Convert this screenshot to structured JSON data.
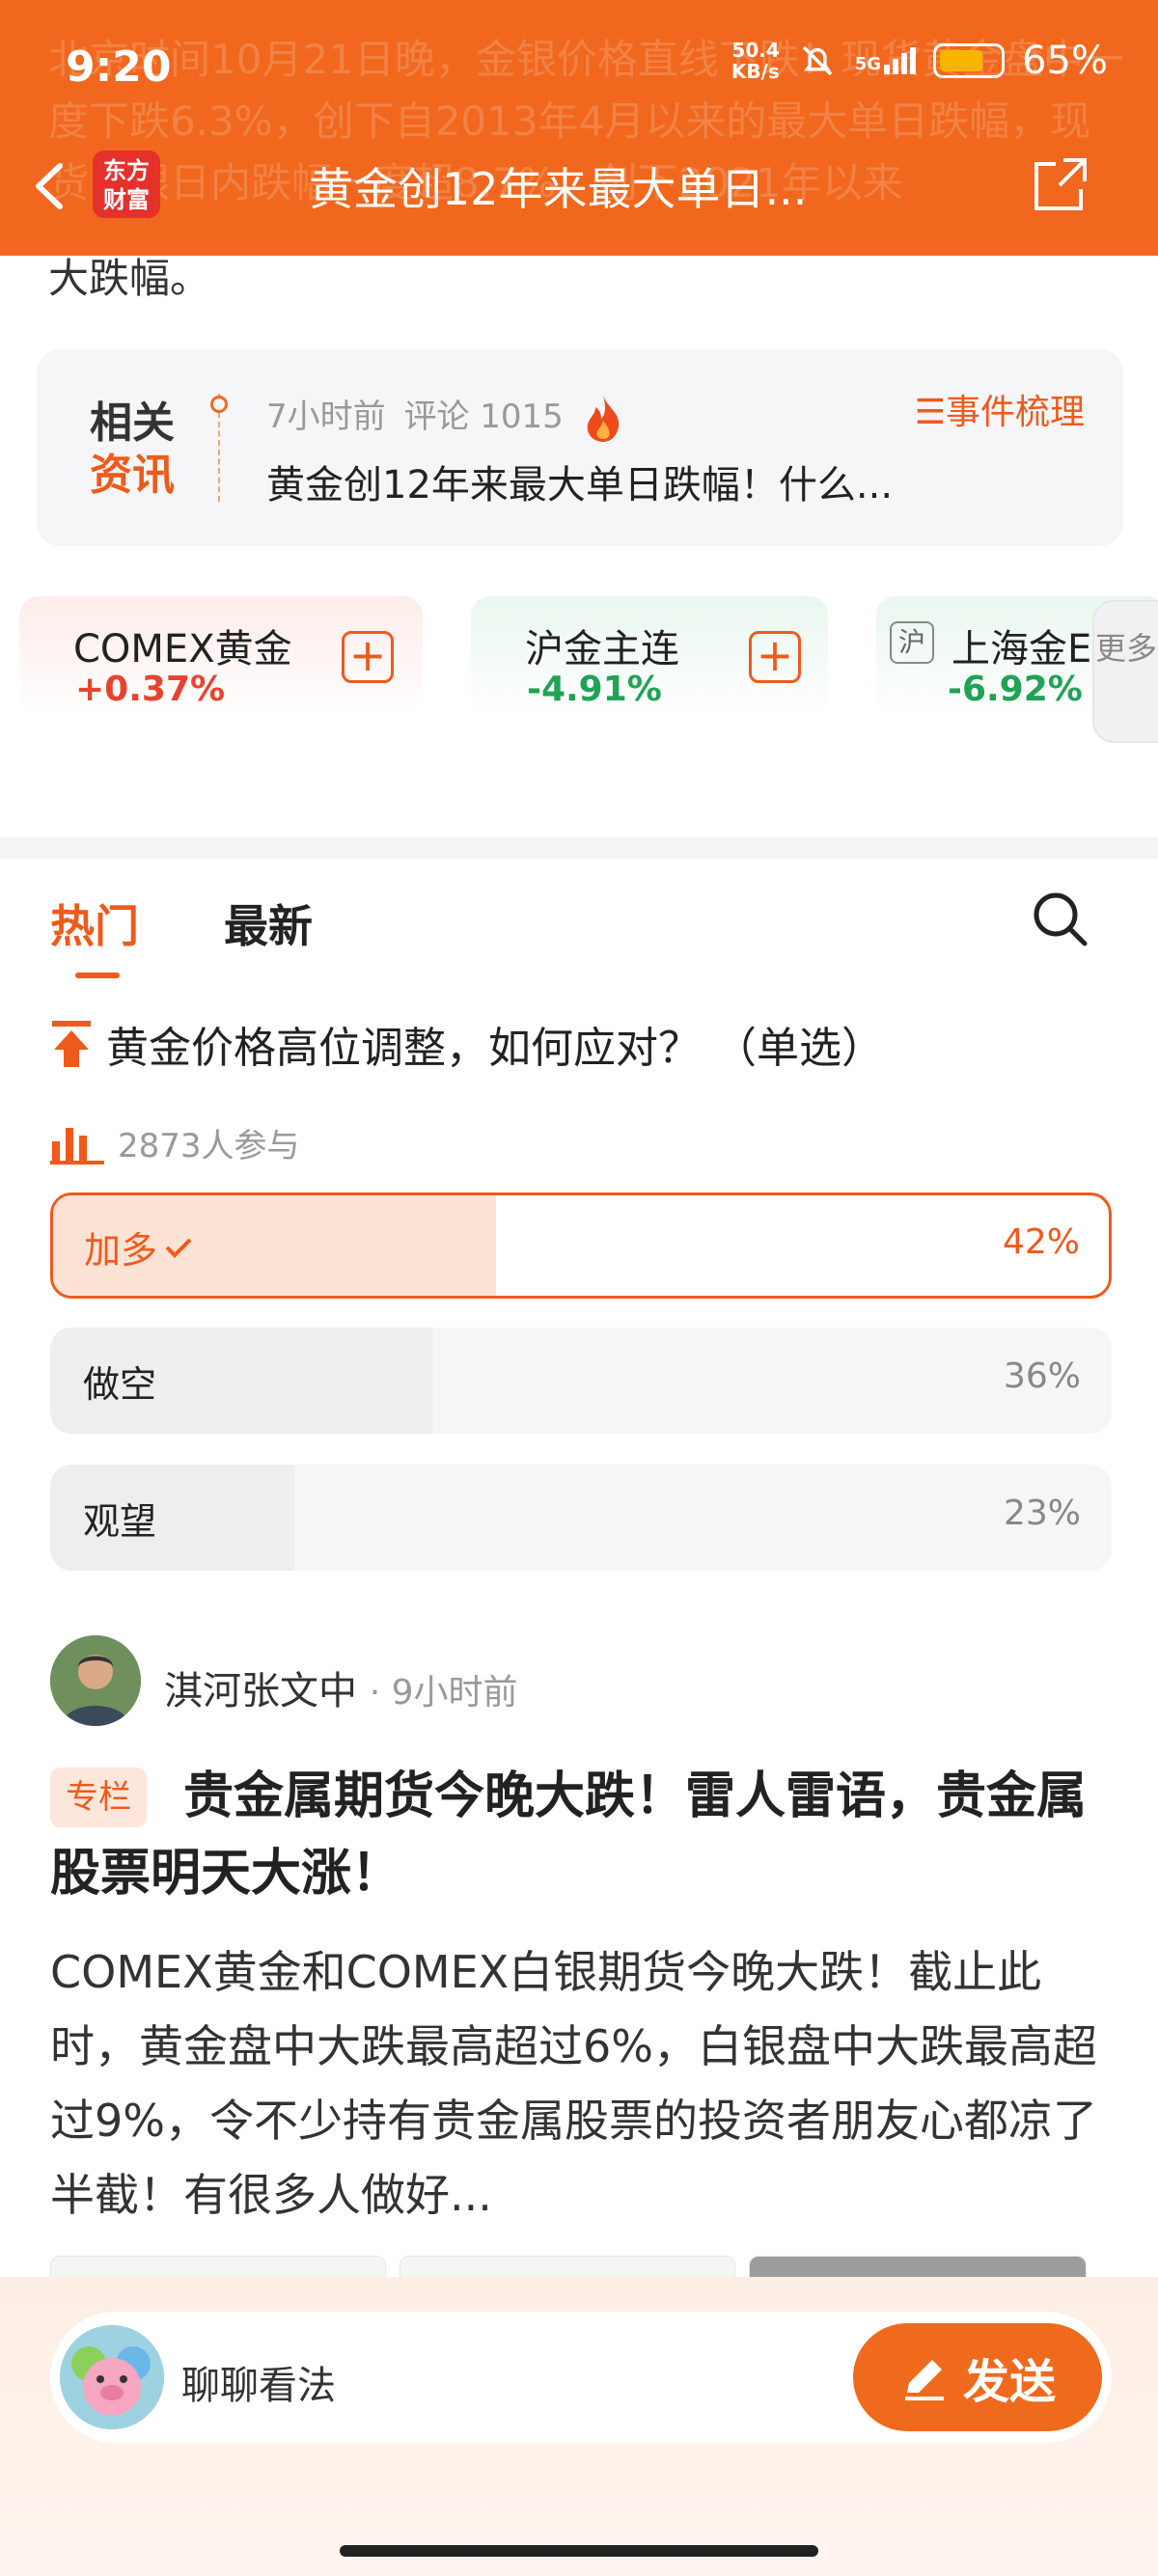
{
  "status_bar": {
    "time": "9:20",
    "net_speed_value": "50.4",
    "net_speed_unit": "KB/s",
    "network": "5G",
    "battery": "65%"
  },
  "header": {
    "logo_text": "东方财富",
    "title": "黄金创12年来最大单日...",
    "ghost_text": "北京时间10月21日晚，金银价格直线下跌！现货黄金盘中一度下跌6.3%，创下自2013年4月以来的最大单日跌幅，现货白银日内跌幅一度超8.7%，创下2021年以来"
  },
  "article": {
    "tail": "大跌幅。"
  },
  "related": {
    "badge_top": "相关",
    "badge_bottom": "资讯",
    "time": "7小时前",
    "comments_label": "评论 1015",
    "title": "黄金创12年来最大单日跌幅！什么...",
    "events_label": "☰事件梳理"
  },
  "quotes": [
    {
      "name": "COMEX黄金",
      "change": "+0.37%",
      "color": "#e8432e"
    },
    {
      "name": "沪金主连",
      "change": "-4.91%",
      "color": "#1fa355"
    },
    {
      "tag": "沪",
      "name": "上海金E",
      "change": "-6.92%",
      "color": "#1fa355"
    }
  ],
  "more_tab": "更多",
  "tabs": {
    "hot": "热门",
    "latest": "最新"
  },
  "poll": {
    "question": "黄金价格高位调整，如何应对？ （单选）",
    "participants": "2873人参与",
    "options": [
      {
        "label": "加多",
        "percent": "42%",
        "value": 42,
        "selected": true
      },
      {
        "label": "做空",
        "percent": "36%",
        "value": 36,
        "selected": false
      },
      {
        "label": "观望",
        "percent": "23%",
        "value": 23,
        "selected": false
      }
    ]
  },
  "post": {
    "author": "淇河张文中",
    "time": "· 9小时前",
    "tag": "专栏",
    "title": "贵金属期货今晚大跌！雷人雷语，贵金属股票明天大涨！",
    "body": "COMEX黄金和COMEX白银期货今晚大跌！截止此时，黄金盘中大跌最高超过6%，白银盘中大跌最高超过9%，令不少持有贵金属股票的投资者朋友心都凉了半截！有很多人做好..."
  },
  "bottom": {
    "placeholder": "聊聊看法",
    "send": "发送"
  },
  "colors": {
    "accent": "#f0671d",
    "up": "#e8432e",
    "down": "#1fa355"
  }
}
